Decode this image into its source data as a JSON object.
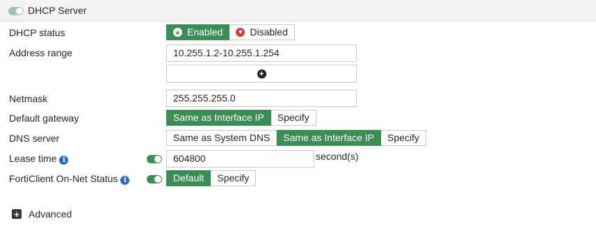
{
  "section": {
    "title": "DHCP Server",
    "enabled": true
  },
  "fields": {
    "dhcp_status": {
      "label": "DHCP status",
      "options": [
        "Enabled",
        "Disabled"
      ],
      "selected": "Enabled"
    },
    "address_range": {
      "label": "Address range",
      "value": "10.255.1.2-10.255.1.254"
    },
    "netmask": {
      "label": "Netmask",
      "value": "255.255.255.0"
    },
    "default_gateway": {
      "label": "Default gateway",
      "options": [
        "Same as Interface IP",
        "Specify"
      ],
      "selected": "Same as Interface IP"
    },
    "dns_server": {
      "label": "DNS server",
      "options": [
        "Same as System DNS",
        "Same as Interface IP",
        "Specify"
      ],
      "selected": "Same as Interface IP"
    },
    "lease_time": {
      "label": "Lease time",
      "toggle_on": true,
      "value": "604800",
      "unit": "second(s)"
    },
    "forticlient": {
      "label": "FortiClient On-Net Status",
      "toggle_on": true,
      "options": [
        "Default",
        "Specify"
      ],
      "selected": "Default"
    }
  },
  "advanced": {
    "label": "Advanced"
  },
  "icons": {
    "toggle": "toggle-switch-icon",
    "info": "info-icon",
    "enabled": "arrow-up-circle-icon",
    "disabled": "arrow-down-circle-icon",
    "add_range": "plus-circle-icon",
    "expand": "plus-square-icon"
  },
  "colors": {
    "accent_green": "#3c8c55",
    "danger_red": "#d63a3a",
    "info_blue": "#2b6cc4",
    "header_bg": "#f3f3f3"
  }
}
